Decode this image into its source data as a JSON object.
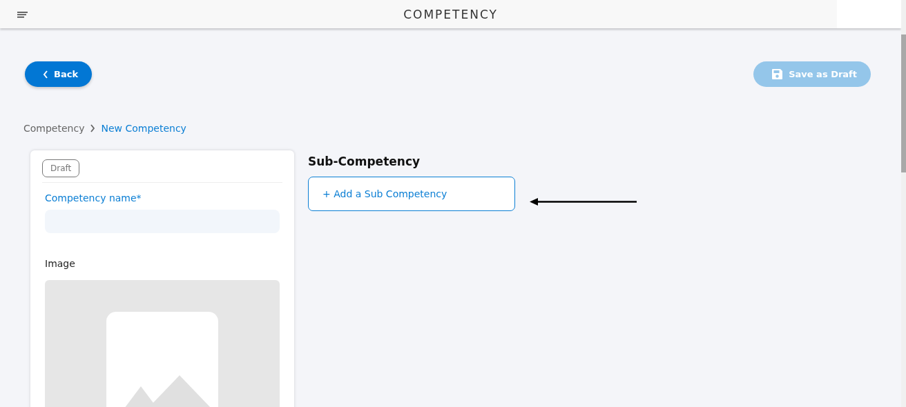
{
  "header": {
    "title": "COMPETENCY"
  },
  "actions": {
    "back": {
      "label": "Back"
    },
    "save": {
      "label": "Save as Draft",
      "disabled": true
    }
  },
  "breadcrumb": [
    {
      "label": "Competency",
      "selected": false
    },
    {
      "label": "New Competency",
      "selected": true
    }
  ],
  "form": {
    "status": "Draft",
    "name_label": "Competency name*",
    "image_label": "Image"
  },
  "sub_competency": {
    "title": "Sub-Competency",
    "add_button": "+ Add a Sub Competency"
  }
}
